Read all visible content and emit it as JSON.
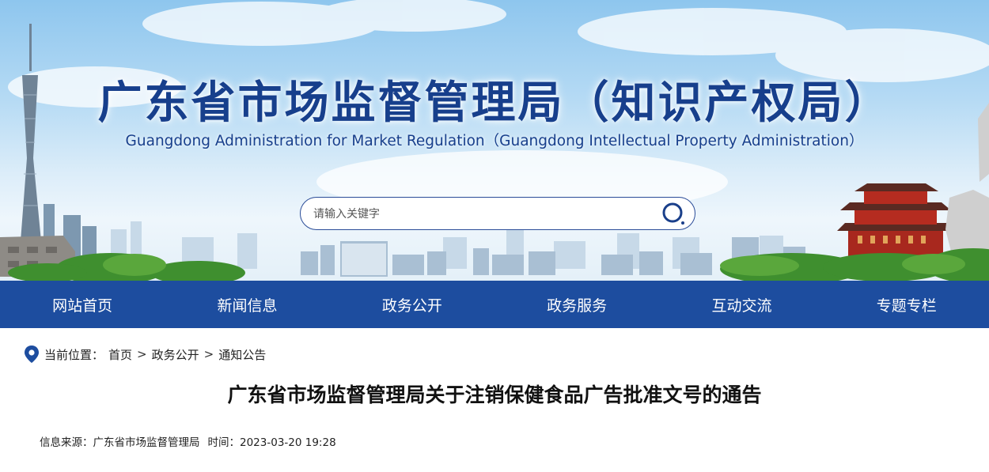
{
  "header": {
    "title": "广东省市场监督管理局（知识产权局）",
    "subtitle": "Guangdong Administration for Market Regulation（Guangdong Intellectual Property Administration）"
  },
  "search": {
    "placeholder": "请输入关键字",
    "icon": "search-icon"
  },
  "nav": {
    "items": [
      "网站首页",
      "新闻信息",
      "政务公开",
      "政务服务",
      "互动交流",
      "专题专栏"
    ]
  },
  "breadcrumb": {
    "label": "当前位置：",
    "icon": "location-pin-icon",
    "items": [
      "首页",
      "政务公开",
      "通知公告"
    ],
    "separator": ">"
  },
  "article": {
    "title": "广东省市场监督管理局关于注销保健食品广告批准文号的通告",
    "source_label": "信息来源：",
    "source": "广东省市场监督管理局",
    "time_label": "时间：",
    "time": "2023-03-20 19:28"
  },
  "colors": {
    "brand_blue": "#1d4d9f",
    "title_blue": "#173f8c"
  }
}
